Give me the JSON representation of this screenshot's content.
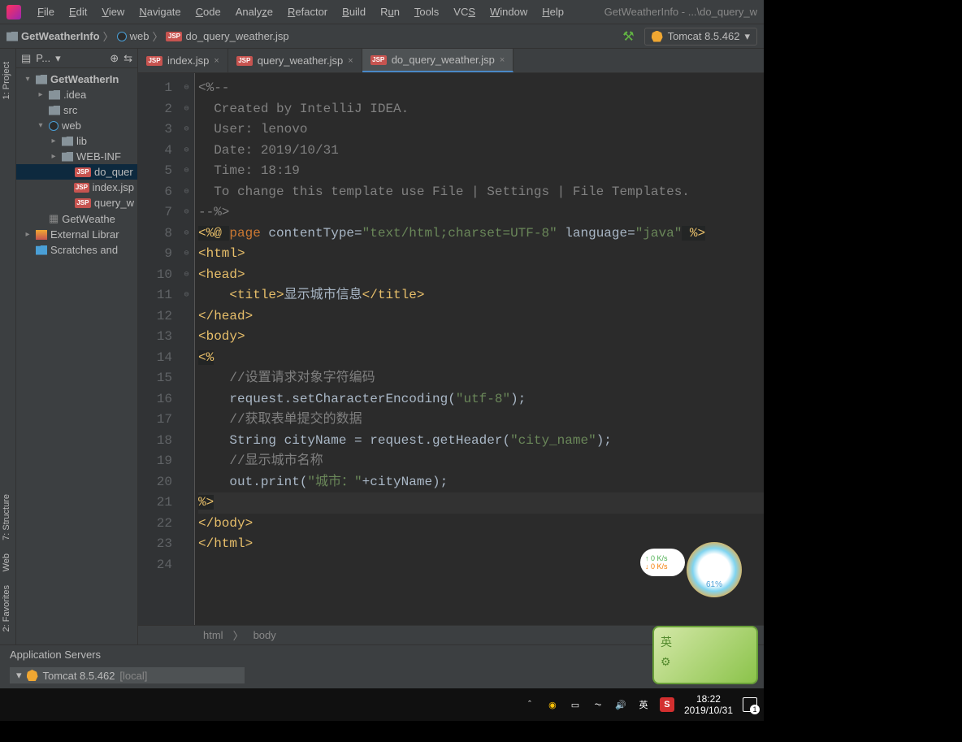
{
  "window": {
    "title": "GetWeatherInfo - ...\\do_query_w"
  },
  "menu": [
    "File",
    "Edit",
    "View",
    "Navigate",
    "Code",
    "Analyze",
    "Refactor",
    "Build",
    "Run",
    "Tools",
    "VCS",
    "Window",
    "Help"
  ],
  "breadcrumb": {
    "items": [
      "GetWeatherInfo",
      "web",
      "do_query_weather.jsp"
    ]
  },
  "run_config": {
    "label": "Tomcat 8.5.462"
  },
  "project_panel": {
    "label": "P...",
    "tree": [
      {
        "label": "GetWeatherIn",
        "type": "root",
        "expanded": true,
        "indent": 0
      },
      {
        "label": ".idea",
        "type": "folder",
        "expanded": false,
        "indent": 1
      },
      {
        "label": "src",
        "type": "folder",
        "indent": 1
      },
      {
        "label": "web",
        "type": "web",
        "expanded": true,
        "indent": 1
      },
      {
        "label": "lib",
        "type": "folder",
        "expanded": false,
        "indent": 2
      },
      {
        "label": "WEB-INF",
        "type": "folder",
        "expanded": false,
        "indent": 2
      },
      {
        "label": "do_quer",
        "type": "jsp",
        "indent": 3,
        "selected": true
      },
      {
        "label": "index.jsp",
        "type": "jsp",
        "indent": 3
      },
      {
        "label": "query_w",
        "type": "jsp",
        "indent": 3
      },
      {
        "label": "GetWeathe",
        "type": "iml",
        "indent": 1
      },
      {
        "label": "External Librar",
        "type": "lib",
        "expanded": false,
        "indent": 0
      },
      {
        "label": "Scratches and",
        "type": "scratch",
        "indent": 0
      }
    ]
  },
  "tabs": [
    {
      "label": "index.jsp",
      "active": false
    },
    {
      "label": "query_weather.jsp",
      "active": false
    },
    {
      "label": "do_query_weather.jsp",
      "active": true
    }
  ],
  "editor": {
    "lines_count": 24,
    "breadcrumb": [
      "html",
      "body"
    ]
  },
  "code": {
    "l1": "<%--",
    "l2": "  Created by IntelliJ IDEA.",
    "l3": "  User: lenovo",
    "l4": "  Date: 2019/10/31",
    "l5": "  Time: 18:19",
    "l6": "  To change this template use File | Settings | File Templates.",
    "l7": "--%>",
    "l8a": "<%@ ",
    "l8b": "page",
    "l8c": " contentType=",
    "l8d": "\"text/html;charset=UTF-8\"",
    "l8e": " language=",
    "l8f": "\"java\"",
    "l8g": " %>",
    "l9": "<html>",
    "l10": "<head>",
    "l11a": "    <title>",
    "l11b": "显示城市信息",
    "l11c": "</title>",
    "l12": "</head>",
    "l13": "<body>",
    "l14": "<%",
    "l15": "    //设置请求对象字符编码",
    "l16a": "    request.setCharacterEncoding(",
    "l16b": "\"utf-8\"",
    "l16c": ");",
    "l17": "    //获取表单提交的数据",
    "l18a": "    String cityName = request.getHeader(",
    "l18b": "\"city_name\"",
    "l18c": ");",
    "l19": "    //显示城市名称",
    "l20a": "    out.print(",
    "l20b": "\"城市：\"",
    "l20c": "+cityName);",
    "l21": "%>",
    "l22": "</body>",
    "l23": "</html>"
  },
  "side_tabs": {
    "project": "1: Project",
    "structure": "7: Structure",
    "web": "Web",
    "favorites": "2: Favorites"
  },
  "bottom": {
    "title": "Application Servers",
    "server": "Tomcat 8.5.462",
    "server_suffix": "[local]"
  },
  "widgets": {
    "net_up": "↑ 0  K/s",
    "net_down": "↓ 0  K/s",
    "face_pct": "61%"
  },
  "taskbar": {
    "ime": "英",
    "sogou": "S",
    "time": "18:22",
    "date": "2019/10/31",
    "notif_count": "1"
  }
}
